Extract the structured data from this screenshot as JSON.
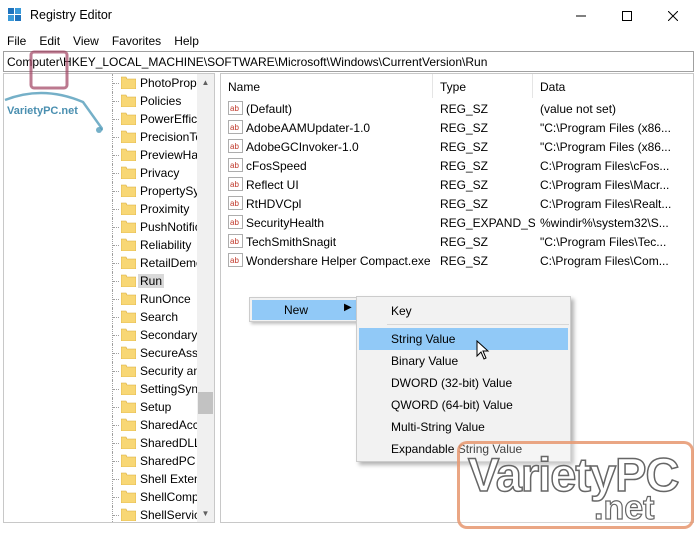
{
  "window": {
    "title": "Registry Editor"
  },
  "menu": [
    "File",
    "Edit",
    "View",
    "Favorites",
    "Help"
  ],
  "address": "Computer\\HKEY_LOCAL_MACHINE\\SOFTWARE\\Microsoft\\Windows\\CurrentVersion\\Run",
  "tree": {
    "items": [
      "PhotoPrope",
      "Policies",
      "PowerEffici",
      "PrecisionTo",
      "PreviewHar",
      "Privacy",
      "PropertySys",
      "Proximity",
      "PushNotific",
      "Reliability",
      "RetailDemc",
      "Run",
      "RunOnce",
      "Search",
      "SecondaryA",
      "SecureAsse",
      "Security an",
      "SettingSync",
      "Setup",
      "SharedAcce",
      "SharedDLLs",
      "SharedPC",
      "Shell Extens",
      "ShellComp",
      "ShellService"
    ],
    "selected": "Run"
  },
  "columns": {
    "name": "Name",
    "type": "Type",
    "data": "Data"
  },
  "values": [
    {
      "name": "(Default)",
      "type": "REG_SZ",
      "data": "(value not set)"
    },
    {
      "name": "AdobeAAMUpdater-1.0",
      "type": "REG_SZ",
      "data": "\"C:\\Program Files (x86..."
    },
    {
      "name": "AdobeGCInvoker-1.0",
      "type": "REG_SZ",
      "data": "\"C:\\Program Files (x86..."
    },
    {
      "name": "cFosSpeed",
      "type": "REG_SZ",
      "data": "C:\\Program Files\\cFos..."
    },
    {
      "name": "Reflect UI",
      "type": "REG_SZ",
      "data": "C:\\Program Files\\Macr..."
    },
    {
      "name": "RtHDVCpl",
      "type": "REG_SZ",
      "data": "C:\\Program Files\\Realt..."
    },
    {
      "name": "SecurityHealth",
      "type": "REG_EXPAND_SZ",
      "data": "%windir%\\system32\\S..."
    },
    {
      "name": "TechSmithSnagit",
      "type": "REG_SZ",
      "data": "\"C:\\Program Files\\Tec..."
    },
    {
      "name": "Wondershare Helper Compact.exe",
      "type": "REG_SZ",
      "data": "C:\\Program Files\\Com..."
    }
  ],
  "context_menu": {
    "new_label": "New"
  },
  "submenu": {
    "items": [
      "Key",
      "String Value",
      "Binary Value",
      "DWORD (32-bit) Value",
      "QWORD (64-bit) Value",
      "Multi-String Value",
      "Expandable String Value"
    ],
    "highlighted": "String Value"
  },
  "watermark": {
    "main": "VarietyPC",
    "suffix": ".net",
    "small": "VarietyPC.net"
  },
  "colors": {
    "highlight": "#91c9f7",
    "folder": "#f8d775",
    "ab_icon": "#c0392b"
  }
}
